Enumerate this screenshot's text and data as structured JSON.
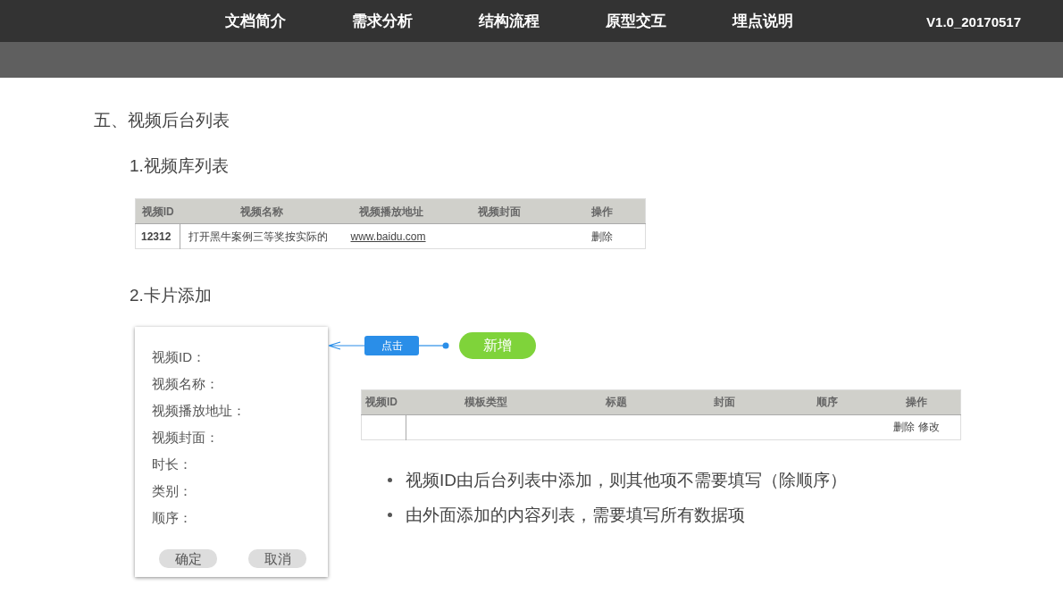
{
  "nav": {
    "items": [
      "文档简介",
      "需求分析",
      "结构流程",
      "原型交互",
      "埋点说明"
    ],
    "version": "V1.0_20170517"
  },
  "section": {
    "title": "五、视频后台列表"
  },
  "library": {
    "title": "1.视频库列表",
    "table": {
      "columns": [
        "视频ID",
        "视频名称",
        "视频播放地址",
        "视频封面",
        "操作"
      ],
      "rows": [
        {
          "id": "12312",
          "name": "打开黑牛案例三等奖按实际的",
          "url": "www.baidu.com",
          "action": "删除"
        }
      ]
    }
  },
  "card_add": {
    "title": "2.卡片添加",
    "form": {
      "fields": [
        "视频ID：",
        "视频名称：",
        "视频播放地址：",
        "视频封面：",
        "时长：",
        "类别：",
        "顺序："
      ],
      "buttons": [
        "确定",
        "取消"
      ]
    },
    "flow": {
      "click_label": "点击",
      "add_button": "新增"
    },
    "table": {
      "columns": [
        "视频ID",
        "模板类型",
        "标题",
        "封面",
        "顺序",
        "操作"
      ],
      "rows": [
        {
          "actions": [
            "删除",
            "修改"
          ]
        }
      ]
    },
    "notes": [
      "视频ID由后台列表中添加，则其他项不需要填写（除顺序）",
      "由外面添加的内容列表，需要填写所有数据项"
    ]
  }
}
